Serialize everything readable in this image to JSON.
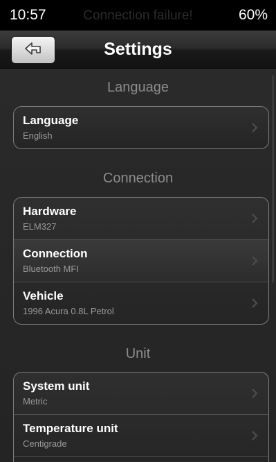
{
  "status_bar": {
    "time": "10:57",
    "message": "Connection failure!",
    "battery": "60%"
  },
  "nav": {
    "title": "Settings",
    "back_icon": "back-arrow-icon"
  },
  "sections": {
    "language": {
      "title": "Language",
      "rows": [
        {
          "label": "Language",
          "value": "English"
        }
      ]
    },
    "connection": {
      "title": "Connection",
      "rows": [
        {
          "label": "Hardware",
          "value": "ELM327"
        },
        {
          "label": "Connection",
          "value": "Bluetooth MFI"
        },
        {
          "label": "Vehicle",
          "value": "1996 Acura 0.8L Petrol"
        }
      ]
    },
    "unit": {
      "title": "Unit",
      "rows": [
        {
          "label": "System unit",
          "value": "Metric"
        },
        {
          "label": "Temperature unit",
          "value": "Centigrade"
        }
      ]
    }
  },
  "colors": {
    "background": "#262626",
    "status_bar": "#000000",
    "section_title": "#8c8c8c",
    "row_label": "#ffffff",
    "row_value": "#9a9a9a",
    "group_border": "#7a7a7a"
  }
}
